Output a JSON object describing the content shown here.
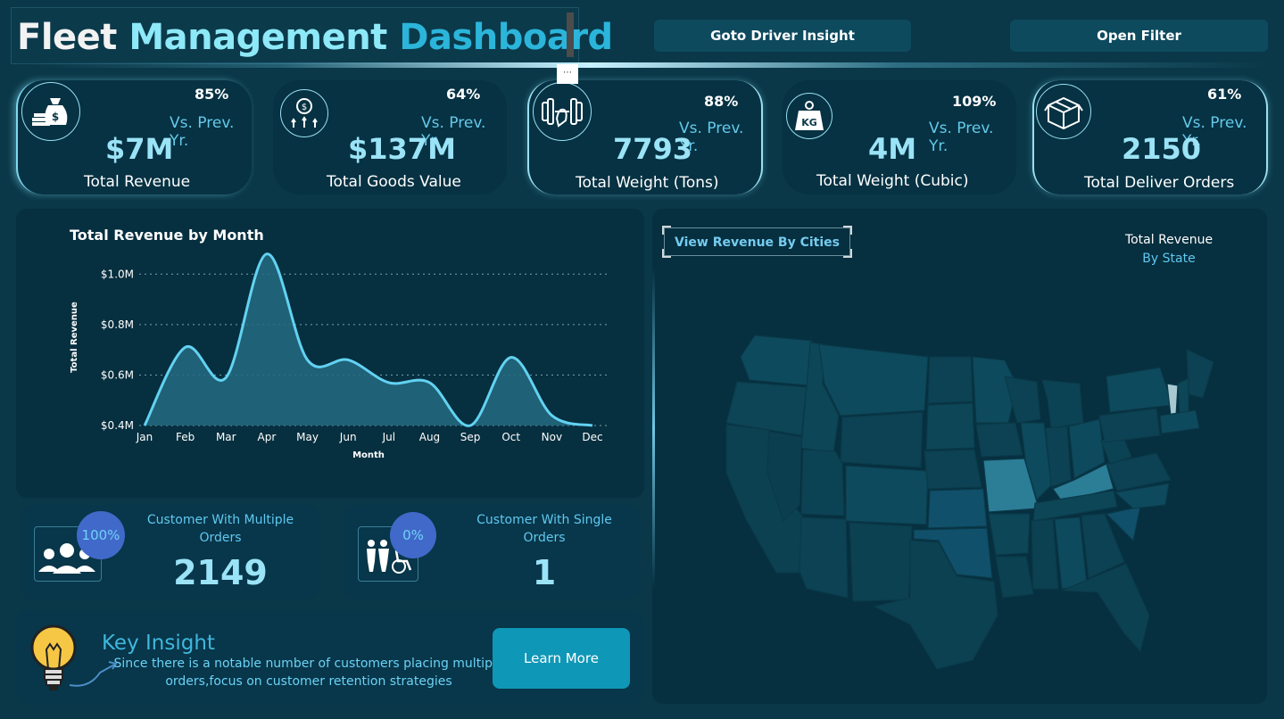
{
  "header": {
    "title_part1": "Fleet",
    "title_part2": "Management",
    "title_part3": "Dashboard",
    "more_options": "⋯",
    "driver_insight_button": "Goto Driver Insight",
    "open_filter_button": "Open Filter"
  },
  "kpis": [
    {
      "pct": "85%",
      "vs": "Vs. Prev. Yr.",
      "value": "$7M",
      "label": "Total Revenue",
      "icon": "money-bag-icon"
    },
    {
      "pct": "64%",
      "vs": "Vs. Prev. Yr.",
      "value": "$137M",
      "label": "Total Goods Value",
      "icon": "coin-growth-icon"
    },
    {
      "pct": "88%",
      "vs": "Vs. Prev. Yr.",
      "value": "7793",
      "label": "Total Weight (Tons)",
      "icon": "dumbbell-icon"
    },
    {
      "pct": "109%",
      "vs": "Vs. Prev. Yr.",
      "value": "4M",
      "label": "Total Weight (Cubic)",
      "icon": "kg-weight-icon"
    },
    {
      "pct": "61%",
      "vs": "Vs. Prev. Yr.",
      "value": "2150",
      "label": "Total Deliver Orders",
      "icon": "package-box-icon"
    }
  ],
  "kg_text": "KG",
  "revenue_chart": {
    "title": "Total Revenue by Month"
  },
  "chart_data": {
    "type": "area",
    "title": "Total Revenue by Month",
    "xlabel": "Month",
    "ylabel": "Total Revenue",
    "categories": [
      "Jan",
      "Feb",
      "Mar",
      "Apr",
      "May",
      "Jun",
      "Jul",
      "Aug",
      "Sep",
      "Oct",
      "Nov",
      "Dec"
    ],
    "values": [
      0.4,
      0.71,
      0.59,
      1.08,
      0.66,
      0.66,
      0.57,
      0.57,
      0.4,
      0.67,
      0.44,
      0.4
    ],
    "yticks": [
      0.4,
      0.6,
      0.8,
      1.0
    ],
    "ytick_labels": [
      "$0.4M",
      "$0.6M",
      "$0.8M",
      "$1.0M"
    ],
    "ylim": [
      0.4,
      1.1
    ],
    "grid": true,
    "line_color": "#62d2f2",
    "fill_color": "#256a80"
  },
  "map": {
    "button": "View Revenue By Cities",
    "legend_title": "Total Revenue",
    "legend_sub": "By State"
  },
  "customers": {
    "multiple": {
      "pct": "100%",
      "title": "Customer With Multiple Orders",
      "value": "2149",
      "icon": "customer-group-icon"
    },
    "single": {
      "pct": "0%",
      "title": "Customer With Single Orders",
      "value": "1",
      "icon": "accessibility-people-icon"
    }
  },
  "insight": {
    "title": "Key Insight",
    "text": "Since there is a notable number of customers placing multiple orders,focus on customer retention strategies",
    "button": "Learn More",
    "icon": "light-bulb-icon"
  },
  "colors": {
    "background": "#0a3848",
    "panel": "#062f3f",
    "accent": "#62d2f2",
    "bubble": "#4169c9"
  }
}
